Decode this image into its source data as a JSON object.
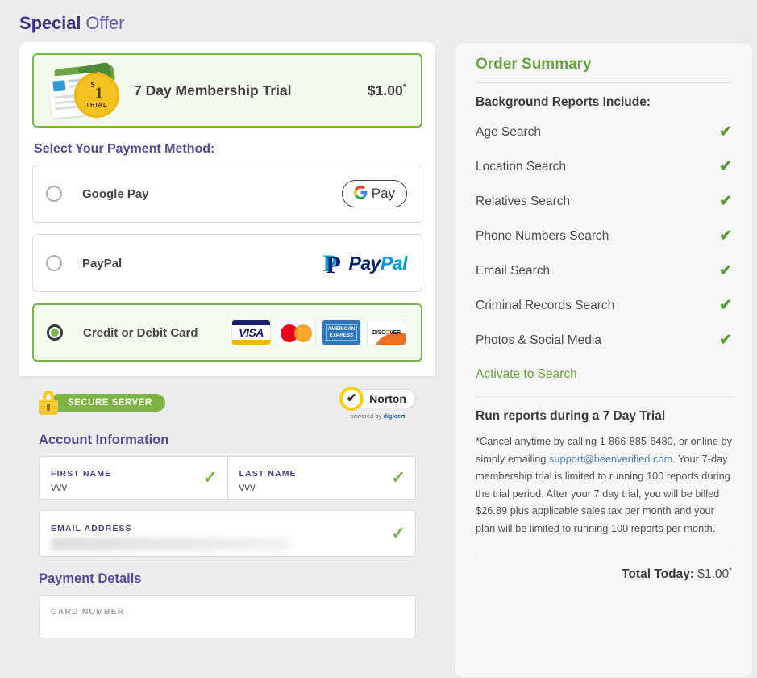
{
  "header": {
    "title_strong": "Special",
    "title_rest": " Offer"
  },
  "offer": {
    "badge_currency": "$",
    "badge_amount": "1",
    "badge_label": "TRIAL",
    "name": "7 Day Membership Trial",
    "price": "$1.00",
    "price_asterisk": "*"
  },
  "payment": {
    "section_label": "Select Your Payment Method:",
    "options": [
      {
        "label": "Google Pay",
        "logo": "google-pay-logo",
        "selected": false,
        "logo_text": "Pay"
      },
      {
        "label": "PayPal",
        "logo": "paypal-logo",
        "selected": false,
        "logo_text_a": "Pay",
        "logo_text_b": "Pal"
      },
      {
        "label": "Credit or Debit Card",
        "logo": "card-brands",
        "selected": true
      }
    ],
    "card_brands": [
      "VISA",
      "MASTERCARD",
      "AMERICAN EXPRESS",
      "DISCOVER"
    ],
    "brand_visa_text": "VISA",
    "brand_amex_line1": "AMERICAN",
    "brand_amex_line2": "EXPRESS",
    "brand_discover_pre": "DISC",
    "brand_discover_o": "O",
    "brand_discover_post": "VER"
  },
  "trust": {
    "secure_server_label": "SECURE SERVER",
    "norton_label": "Norton",
    "norton_check": "✔",
    "norton_sub_pre": "powered by ",
    "norton_sub_brand": "digicert"
  },
  "account": {
    "heading": "Account Information",
    "first_name_label": "FIRST NAME",
    "first_name_value": "vvv",
    "last_name_label": "LAST NAME",
    "last_name_value": "vvv",
    "email_label": "EMAIL ADDRESS",
    "email_value": "",
    "valid_icon": "✓"
  },
  "payment_details": {
    "heading": "Payment Details",
    "card_number_label": "CARD NUMBER"
  },
  "summary": {
    "title": "Order Summary",
    "reports_heading": "Background Reports Include:",
    "items": [
      {
        "label": "Age Search",
        "included": true
      },
      {
        "label": "Location Search",
        "included": true
      },
      {
        "label": "Relatives Search",
        "included": true
      },
      {
        "label": "Phone Numbers Search",
        "included": true
      },
      {
        "label": "Email Search",
        "included": true
      },
      {
        "label": "Criminal Records Search",
        "included": true
      },
      {
        "label": "Photos & Social Media",
        "included": true
      }
    ],
    "check_glyph": "✔",
    "activate_link": "Activate to Search",
    "run_heading": "Run reports during a 7 Day Trial",
    "fine_print_part1": "*Cancel anytime by calling 1-866-885-6480, or online by simply emailing ",
    "fine_print_email": "support@beenverified.com",
    "fine_print_part2": ". Your 7-day membership trial is limited to running 100 reports during the trial period. After your 7 day trial, you will be billed $26.89 plus applicable sales tax per month and your plan will be limited to running 100 reports per month.",
    "total_label": "Total Today:",
    "total_value": "$1.00",
    "total_asterisk": "*"
  },
  "colors": {
    "brand_purple": "#3b3486",
    "accent_green": "#6aa442",
    "selected_border": "#79b44c",
    "link_blue": "#4a7fc1"
  }
}
